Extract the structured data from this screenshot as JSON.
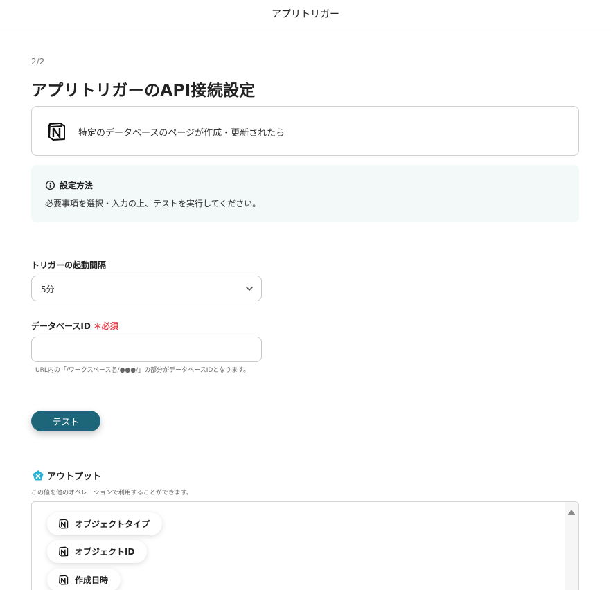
{
  "header": {
    "title": "アプリトリガー"
  },
  "step": "2/2",
  "page_title": "アプリトリガーのAPI接続設定",
  "trigger": {
    "text": "特定のデータベースのページが作成・更新されたら",
    "icon": "notion-logo-icon"
  },
  "info": {
    "title": "設定方法",
    "text": "必要事項を選択・入力の上、テストを実行してください。",
    "icon": "info-circle-icon"
  },
  "interval": {
    "label": "トリガーの起動間隔",
    "value": "5分"
  },
  "database_id": {
    "label": "データベースID",
    "required_mark": "＊必須",
    "value": "",
    "placeholder": "",
    "hint": "URL内の「/ワークスペース名/●●●/」の部分がデータベースIDとなります。"
  },
  "test_button": "テスト",
  "output": {
    "title": "アウトプット",
    "description": "この値を他のオペレーションで利用することができます。",
    "icon": "output-badge-icon",
    "items": [
      {
        "label": "オブジェクトタイプ"
      },
      {
        "label": "オブジェクトID"
      },
      {
        "label": "作成日時"
      }
    ]
  },
  "colors": {
    "accent": "#1d6679",
    "required": "#e0424e",
    "info_bg": "#f3f9f8",
    "output_badge": "#2bb3d6"
  }
}
